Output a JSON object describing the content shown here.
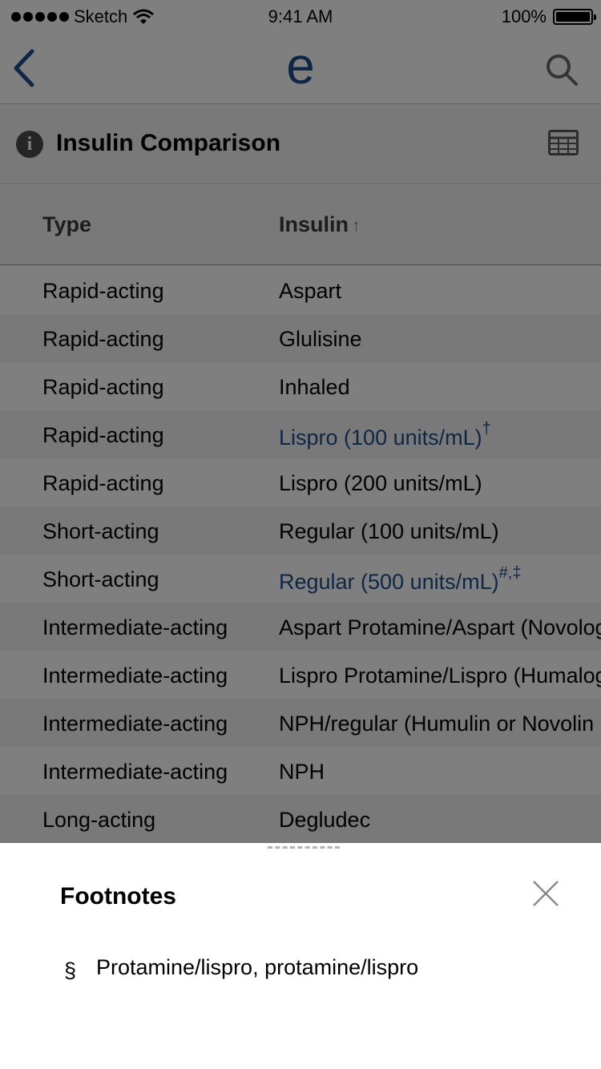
{
  "status_bar": {
    "carrier": "Sketch",
    "time": "9:41 AM",
    "battery": "100%"
  },
  "nav": {
    "logo": "e",
    "back_icon": "chevron-left-icon",
    "search_icon": "search-icon"
  },
  "section": {
    "title": "Insulin Comparison",
    "info_icon": "info-icon",
    "table_icon": "table-grid-icon"
  },
  "table": {
    "headers": {
      "type": "Type",
      "insulin": "Insulin",
      "sort_indicator": "↑"
    },
    "rows": [
      {
        "type": "Rapid-acting",
        "insulin": "Aspart",
        "sup": "",
        "link": false
      },
      {
        "type": "Rapid-acting",
        "insulin": "Glulisine",
        "sup": "",
        "link": false
      },
      {
        "type": "Rapid-acting",
        "insulin": "Inhaled",
        "sup": "",
        "link": false
      },
      {
        "type": "Rapid-acting",
        "insulin": "Lispro (100 units/mL)",
        "sup": "†",
        "link": true
      },
      {
        "type": "Rapid-acting",
        "insulin": "Lispro (200 units/mL)",
        "sup": "",
        "link": false
      },
      {
        "type": "Short-acting",
        "insulin": "Regular (100 units/mL)",
        "sup": "",
        "link": false
      },
      {
        "type": "Short-acting",
        "insulin": "Regular (500 units/mL)",
        "sup": "#,‡",
        "link": true
      },
      {
        "type": "Intermediate-acting",
        "insulin": "Aspart Protamine/Aspart (Novolog",
        "sup": "",
        "link": false
      },
      {
        "type": "Intermediate-acting",
        "insulin": "Lispro Protamine/Lispro (Humalog",
        "sup": "",
        "link": false
      },
      {
        "type": "Intermediate-acting",
        "insulin": "NPH/regular (Humulin or Novolin",
        "sup": "",
        "link": false
      },
      {
        "type": "Intermediate-acting",
        "insulin": "NPH",
        "sup": "",
        "link": false
      },
      {
        "type": "Long-acting",
        "insulin": "Degludec",
        "sup": "",
        "link": false
      }
    ]
  },
  "footnotes": {
    "title": "Footnotes",
    "close_icon": "close-icon",
    "items": [
      {
        "symbol": "§",
        "text": "Protamine/lispro, protamine/lispro"
      }
    ]
  }
}
